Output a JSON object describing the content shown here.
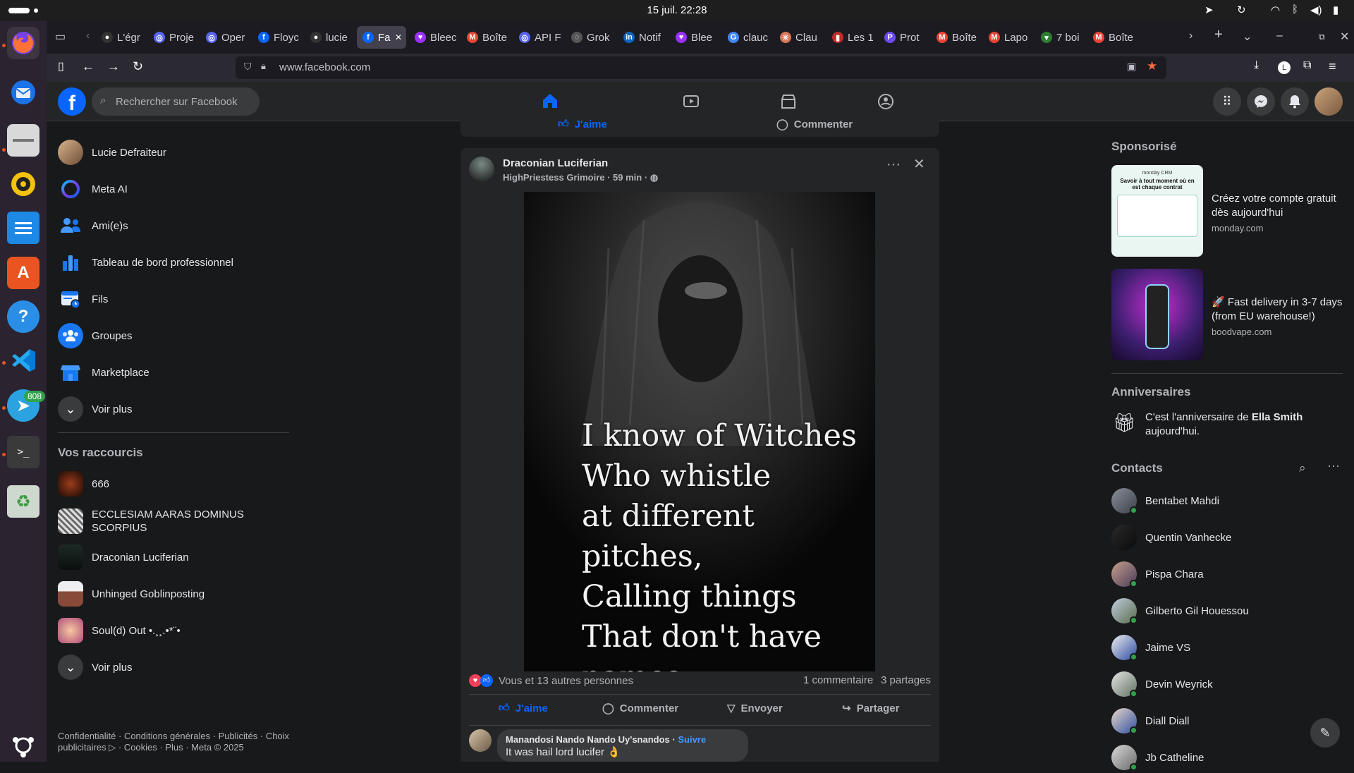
{
  "os": {
    "clock": "15 juil.  22:28"
  },
  "dock": {
    "telegram_badge": "808"
  },
  "tabs": [
    {
      "label": "L'égr",
      "icon": "github-icon",
      "color": "#333"
    },
    {
      "label": "Proje",
      "icon": "openai-icon",
      "color": "#5865f2"
    },
    {
      "label": "Oper",
      "icon": "openai-icon",
      "color": "#5865f2"
    },
    {
      "label": "Floyc",
      "icon": "facebook-icon",
      "color": "#0866ff"
    },
    {
      "label": "lucie",
      "icon": "github-icon",
      "color": "#333"
    },
    {
      "label": "Fa",
      "icon": "facebook-icon",
      "color": "#0866ff"
    },
    {
      "label": "Bleec",
      "icon": "heart-icon",
      "color": "#9b30ff"
    },
    {
      "label": "Boîte",
      "icon": "gmail-icon",
      "color": "#ea4335"
    },
    {
      "label": "API F",
      "icon": "openai-icon",
      "color": "#5865f2"
    },
    {
      "label": "Grok",
      "icon": "grok-icon",
      "color": "#555"
    },
    {
      "label": "Notif",
      "icon": "linkedin-icon",
      "color": "#0a66c2"
    },
    {
      "label": "Blee",
      "icon": "heart-icon",
      "color": "#9b30ff"
    },
    {
      "label": "clauc",
      "icon": "google-icon",
      "color": "#4285f4"
    },
    {
      "label": "Clau",
      "icon": "claude-icon",
      "color": "#d97757"
    },
    {
      "label": "Les 1",
      "icon": "bookmark-icon",
      "color": "#c62828"
    },
    {
      "label": "Prot",
      "icon": "proton-icon",
      "color": "#6d4aff"
    },
    {
      "label": "Boîte",
      "icon": "gmail-icon",
      "color": "#ea4335"
    },
    {
      "label": "Lapo",
      "icon": "gmail-icon",
      "color": "#ea4335"
    },
    {
      "label": "7 boi",
      "icon": "cat-icon",
      "color": "#2e7d32"
    },
    {
      "label": "Boîte",
      "icon": "gmail-icon",
      "color": "#ea4335"
    }
  ],
  "navbar": {
    "url": "www.facebook.com"
  },
  "header": {
    "search_placeholder": "Rechercher sur Facebook"
  },
  "sidebar": {
    "items": [
      {
        "label": "Lucie Defraiteur"
      },
      {
        "label": "Meta AI"
      },
      {
        "label": "Ami(e)s"
      },
      {
        "label": "Tableau de bord professionnel"
      },
      {
        "label": "Fils"
      },
      {
        "label": "Groupes"
      },
      {
        "label": "Marketplace"
      },
      {
        "label": "Voir plus"
      }
    ],
    "shortcuts_title": "Vos raccourcis",
    "shortcuts": [
      {
        "label": "666"
      },
      {
        "label": "ECCLESIAM AARAS DOMINUS SCORPIUS"
      },
      {
        "label": "Draconian Luciferian"
      },
      {
        "label": "Unhinged Goblinposting"
      },
      {
        "label": "Soul(d) Out •.¸¸.•*¨•"
      },
      {
        "label": "Voir plus"
      }
    ],
    "footer": "Confidentialité · Conditions générales · Publicités · Choix publicitaires ▷ · Cookies · Plus · Meta © 2025"
  },
  "prev_post": {
    "like_label": "J'aime",
    "comment_label": "Commenter"
  },
  "post": {
    "author": "Draconian Luciferian",
    "subline": "HighPriestess Grimoire · 59 min ·",
    "image_text": "I know of Witches\nWho whistle\nat different pitches,\nCalling things\nThat don't have\nnames...",
    "reactions_text": "Vous et 13 autres personnes",
    "comments_count": "1 commentaire",
    "shares_count": "3 partages",
    "actions": {
      "like": "J'aime",
      "comment": "Commenter",
      "send": "Envoyer",
      "share": "Partager"
    },
    "comment": {
      "author": "Manandosi Nando Nando Uy'snandos",
      "follow": "Suivre",
      "text": "It was hail lord lucifer 👌"
    }
  },
  "right": {
    "sponsored_title": "Sponsorisé",
    "ads": [
      {
        "text": "Créez votre compte gratuit dès aujourd'hui",
        "domain": "monday.com",
        "thumb_title": "Savoir à tout moment où en est chaque contrat",
        "thumb_brand": "monday CRM"
      },
      {
        "text": "🚀 Fast delivery in 3-7 days (from EU warehouse!)",
        "domain": "boodvape.com"
      }
    ],
    "birthdays_title": "Anniversaires",
    "birthday_prefix": "C'est l'anniversaire de ",
    "birthday_name": "Ella Smith",
    "birthday_suffix": " aujourd'hui.",
    "contacts_title": "Contacts",
    "contacts": [
      {
        "name": "Bentabet Mahdi"
      },
      {
        "name": "Quentin Vanhecke"
      },
      {
        "name": "Pispa Chara"
      },
      {
        "name": "Gilberto Gil Houessou"
      },
      {
        "name": "Jaime VS"
      },
      {
        "name": "Devin Weyrick"
      },
      {
        "name": "Diall Diall"
      },
      {
        "name": "Jb Catheline"
      }
    ]
  }
}
